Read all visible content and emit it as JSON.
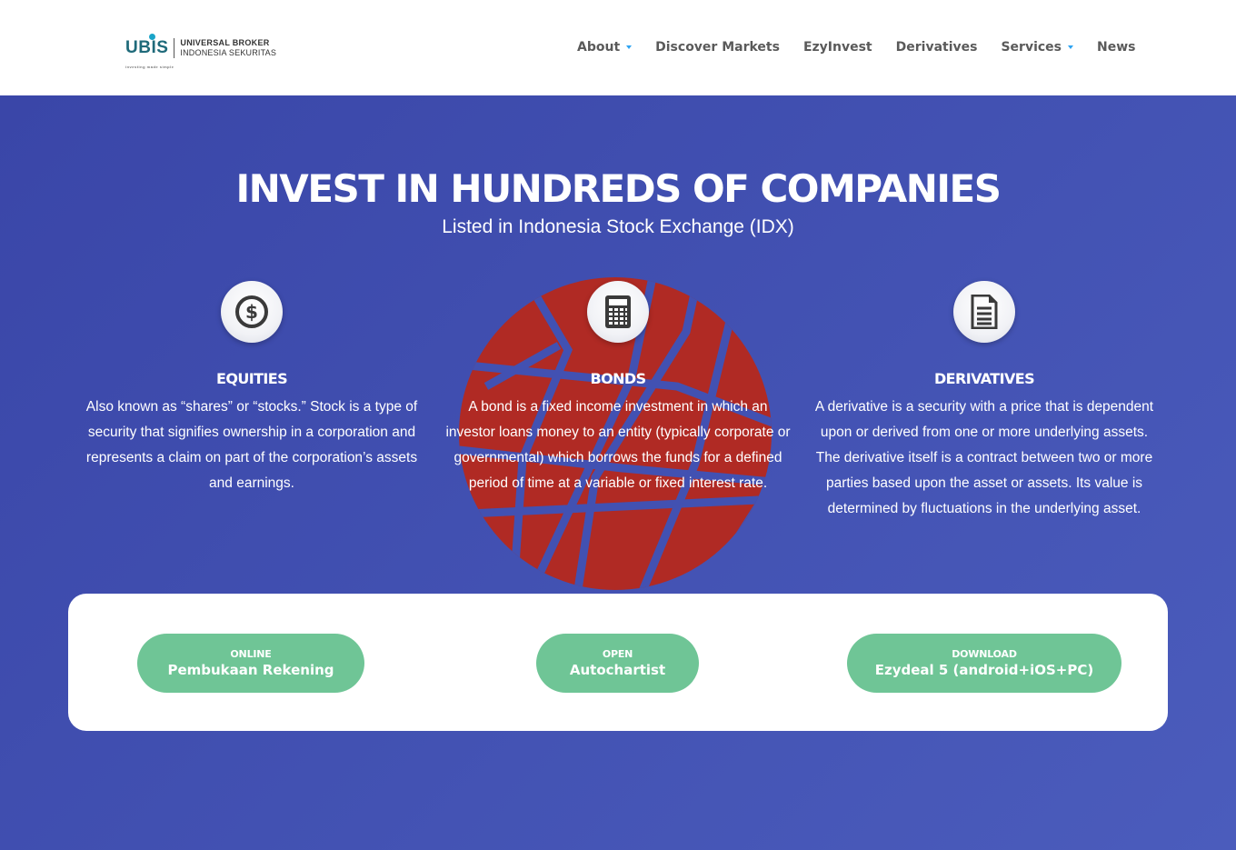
{
  "brand": {
    "mark": "UBIS",
    "tagline": "investing made simple",
    "name_line1": "UNIVERSAL BROKER",
    "name_line2": "INDONESIA SEKURITAS"
  },
  "nav": {
    "items": [
      {
        "label": "About",
        "has_dropdown": true
      },
      {
        "label": "Discover Markets",
        "has_dropdown": false
      },
      {
        "label": "EzyInvest",
        "has_dropdown": false
      },
      {
        "label": "Derivatives",
        "has_dropdown": false
      },
      {
        "label": "Services",
        "has_dropdown": true
      },
      {
        "label": "News",
        "has_dropdown": false
      }
    ]
  },
  "hero": {
    "title": "INVEST IN HUNDREDS OF COMPANIES",
    "subtitle": "Listed in Indonesia Stock Exchange (IDX)"
  },
  "features": [
    {
      "icon": "dollar-icon",
      "title": "EQUITIES",
      "text": "Also known as “shares” or “stocks.” Stock is a type of security that signifies ownership in a corporation and represents a claim on part of the corporation’s assets and earnings."
    },
    {
      "icon": "calculator-icon",
      "title": "BONDS",
      "text": "A bond is a fixed income investment in which an investor loans money to an entity (typically corporate or governmental) which borrows the funds for a defined period of time at a variable or fixed interest rate."
    },
    {
      "icon": "document-icon",
      "title": "DERIVATIVES",
      "text": "A derivative is a security with a price that is dependent upon or derived from one or more underlying assets. The derivative itself is a contract between two or more parties based upon the asset or assets. Its value is determined by fluctuations in the underlying asset."
    }
  ],
  "cta": [
    {
      "small": "ONLINE",
      "big": "Pembukaan Rekening"
    },
    {
      "small": "OPEN",
      "big": "Autochartist"
    },
    {
      "small": "DOWNLOAD",
      "big": "Ezydeal 5 (android+iOS+PC)"
    }
  ],
  "colors": {
    "hero_bg": "#4251b2",
    "accent_blue": "#2ea3f2",
    "globe_red": "#b02a24",
    "button_green": "#6fc596",
    "nav_text": "#5a5a5a"
  }
}
